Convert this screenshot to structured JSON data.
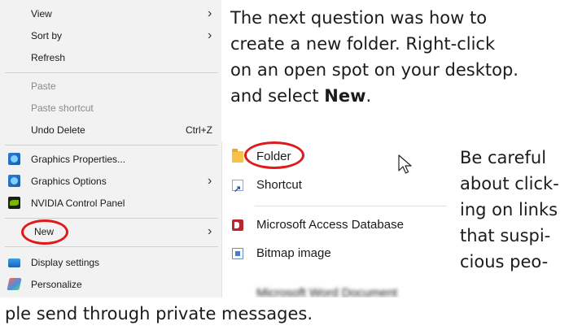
{
  "context_menu": {
    "items": [
      {
        "label": "View",
        "has_submenu": true
      },
      {
        "label": "Sort by",
        "has_submenu": true
      },
      {
        "label": "Refresh"
      },
      {
        "label": "Paste",
        "disabled": true
      },
      {
        "label": "Paste shortcut",
        "disabled": true
      },
      {
        "label": "Undo Delete",
        "shortcut": "Ctrl+Z"
      },
      {
        "label": "Graphics Properties...",
        "icon": "graphics-icon"
      },
      {
        "label": "Graphics Options",
        "icon": "graphics-icon",
        "has_submenu": true
      },
      {
        "label": "NVIDIA Control Panel",
        "icon": "nvidia-icon"
      },
      {
        "label": "New",
        "has_submenu": true,
        "highlighted": true
      },
      {
        "label": "Display settings",
        "icon": "display-icon"
      },
      {
        "label": "Personalize",
        "icon": "personalize-icon"
      }
    ]
  },
  "submenu": {
    "items": [
      {
        "label": "Folder",
        "icon": "folder-icon",
        "highlighted": true
      },
      {
        "label": "Shortcut",
        "icon": "shortcut-icon"
      },
      {
        "label": "Microsoft Access Database",
        "icon": "access-icon"
      },
      {
        "label": "Bitmap image",
        "icon": "bitmap-icon"
      }
    ],
    "truncated_item": "Microsoft Word Document"
  },
  "text": {
    "para1_lines": [
      "The next question was how to",
      "create a new folder. Right-click",
      "on an open spot on your desktop.",
      "and select "
    ],
    "para1_bold": "New",
    "para1_end": ".",
    "para2_lines": [
      "Be careful",
      "about click-",
      "ing on links",
      "that suspi-",
      "cious peo-"
    ],
    "para2_last": "ple send through private messages."
  },
  "colors": {
    "menu_bg": "#f2f2f2",
    "highlight_oval": "#e01a1a",
    "text": "#1b1b1b"
  }
}
